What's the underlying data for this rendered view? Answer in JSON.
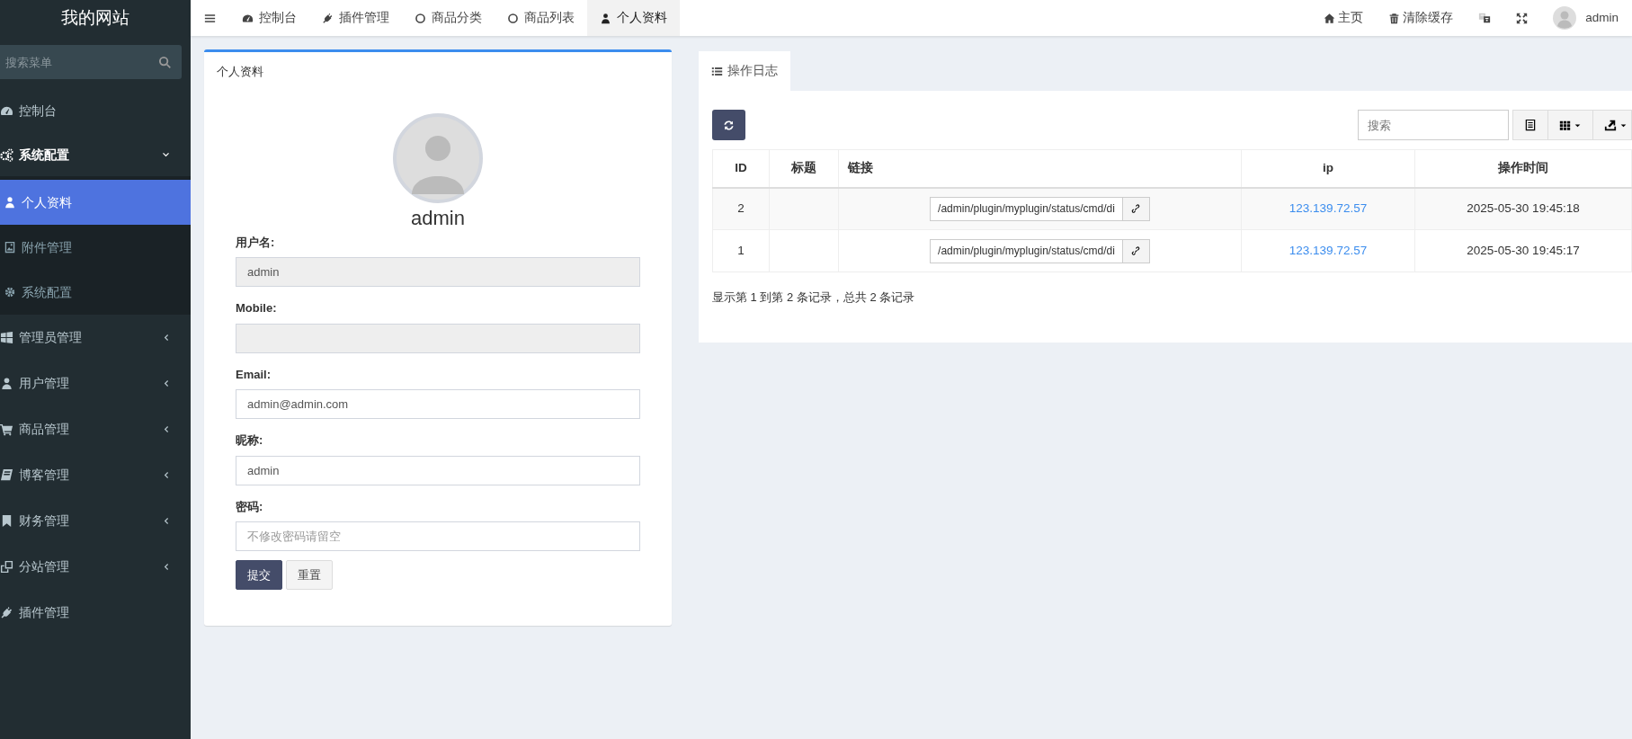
{
  "brand": "我的网站",
  "top_nav": [
    {
      "label": "控制台",
      "selected": false
    },
    {
      "label": "插件管理",
      "selected": false
    },
    {
      "label": "商品分类",
      "selected": false
    },
    {
      "label": "商品列表",
      "selected": false
    },
    {
      "label": "个人资料",
      "selected": true
    }
  ],
  "top_right": {
    "links": [
      "主页",
      "清除缓存"
    ],
    "user": "admin"
  },
  "sidebar": {
    "search_placeholder": "搜索菜单",
    "items": [
      {
        "label": "控制台",
        "selected": false
      },
      {
        "label": "系统配置",
        "selected": false,
        "expanded": true,
        "children": [
          {
            "label": "个人资料",
            "selected": true
          },
          {
            "label": "附件管理",
            "selected": false
          },
          {
            "label": "系统配置",
            "selected": false
          }
        ]
      },
      {
        "label": "管理员管理",
        "selected": false,
        "expanded": false
      },
      {
        "label": "用户管理",
        "selected": false,
        "expanded": false
      },
      {
        "label": "商品管理",
        "selected": false,
        "expanded": false
      },
      {
        "label": "博客管理",
        "selected": false,
        "expanded": false
      },
      {
        "label": "财务管理",
        "selected": false,
        "expanded": false
      },
      {
        "label": "分站管理",
        "selected": false,
        "expanded": false
      },
      {
        "label": "插件管理",
        "selected": false
      }
    ]
  },
  "profile": {
    "title": "个人资料",
    "name": "admin",
    "fields": [
      {
        "label": "用户名:",
        "value": "admin",
        "disabled": true
      },
      {
        "label": "Mobile:",
        "disabled": true
      },
      {
        "label": "Email:",
        "value": "admin@admin.com",
        "disabled": false
      },
      {
        "label": "昵称:",
        "value": "admin",
        "disabled": false
      },
      {
        "label": "密码:",
        "placeholder": "不修改密码请留空",
        "disabled": false
      }
    ],
    "buttons": [
      {
        "label": "提交",
        "kind": "primary"
      },
      {
        "label": "重置",
        "kind": "default"
      }
    ]
  },
  "log": {
    "tab": "操作日志",
    "search_placeholder": "搜索",
    "columns": [
      "ID",
      "标题",
      "链接",
      "ip",
      "操作时间"
    ],
    "rows": [
      {
        "id": "2",
        "link": "/admin/plugin/myplugin/status/cmd/di",
        "ip": "123.139.72.57",
        "time": "2025-05-30 19:45:18"
      },
      {
        "id": "1",
        "link": "/admin/plugin/myplugin/status/cmd/di",
        "ip": "123.139.72.57",
        "time": "2025-05-30 19:45:17"
      }
    ],
    "footer": "显示第 1 到第 2 条记录，总共 2 条记录"
  }
}
